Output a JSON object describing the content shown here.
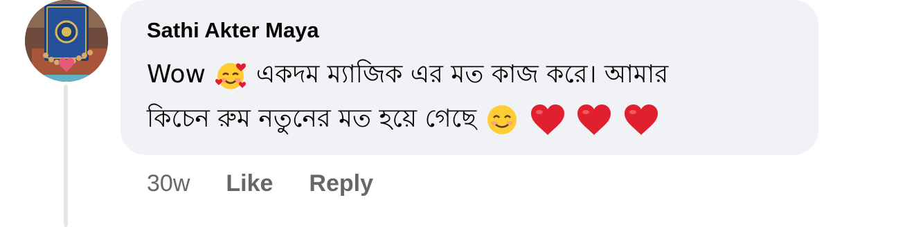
{
  "comment": {
    "author": "Sathi Akter Maya",
    "line1_prefix": "Wow",
    "line1_text": "একদম ম্যাজিক এর মত কাজ করে। আমার",
    "line2_text": "কিচেন রুম নতুনের মত হয়ে গেছে",
    "emojis": [
      "smiling-face-with-hearts-icon",
      "smiling-face-icon",
      "red-heart-icon",
      "red-heart-icon",
      "red-heart-icon"
    ]
  },
  "actions": {
    "timestamp": "30w",
    "like_label": "Like",
    "reply_label": "Reply"
  },
  "colors": {
    "bubble_bg": "#f0f2f5",
    "text": "#050505",
    "secondary_text": "#65676b",
    "heart": "#e0202e"
  }
}
